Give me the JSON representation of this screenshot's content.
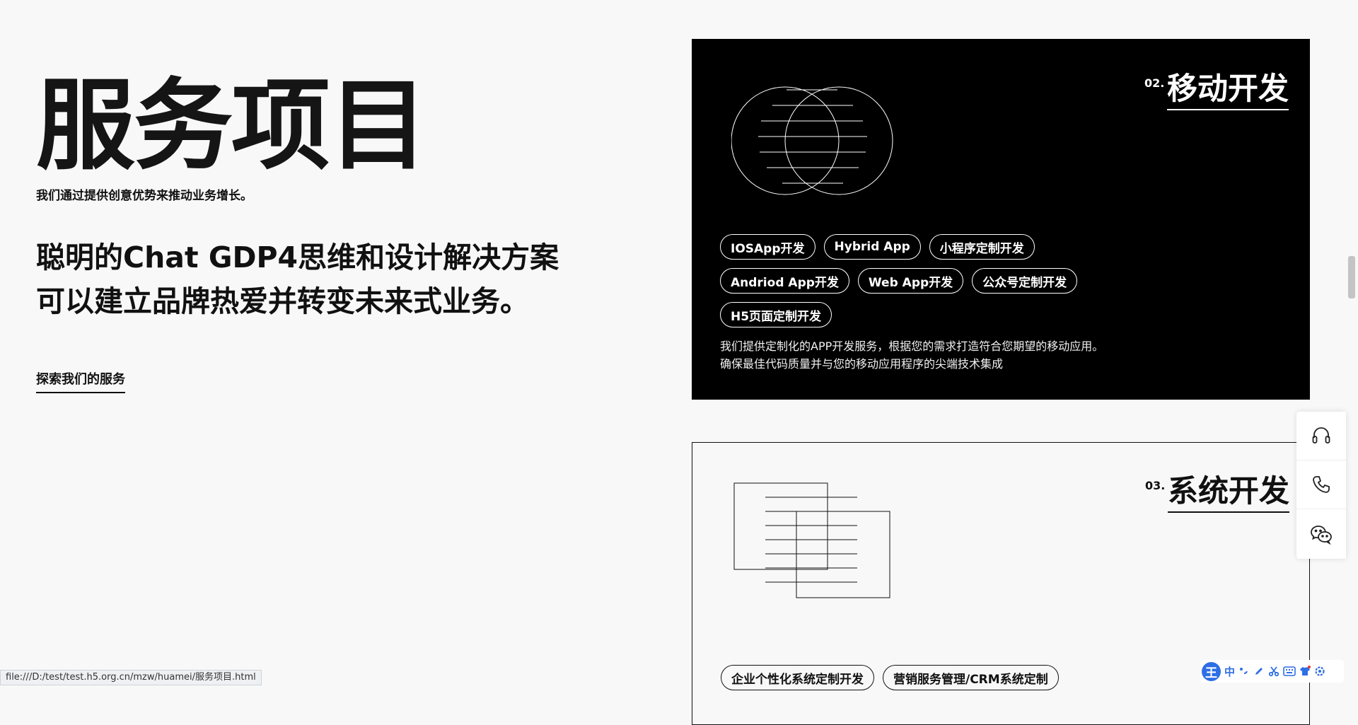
{
  "page": {
    "title": "服务项目",
    "subtitle": "我们通过提供创意优势来推动业务增长。",
    "hero_lines": [
      "聪明的Chat GDP4思维和设计解决方案",
      "可以建立品牌热爱并转变未来式业务。"
    ],
    "explore_link": "探索我们的服务"
  },
  "cards": [
    {
      "num": "02.",
      "title": "移动开发",
      "tags": [
        "IOSApp开发",
        "Hybrid App",
        "小程序定制开发",
        "Andriod App开发",
        "Web App开发",
        "公众号定制开发",
        "H5页面定制开发"
      ],
      "desc": [
        "我们提供定制化的APP开发服务，根据您的需求打造符合您期望的移动应用。",
        "确保最佳代码质量并与您的移动应用程序的尖端技术集成"
      ]
    },
    {
      "num": "03.",
      "title": "系统开发",
      "tags": [
        "企业个性化系统定制开发",
        "营销服务管理/CRM系统定制"
      ]
    }
  ],
  "float_bar": {
    "icons": [
      "headset-icon",
      "phone-icon",
      "wechat-icon"
    ]
  },
  "status_bar": {
    "url": "file:///D:/test/test.h5.org.cn/mzw/huamei/服务项目.html"
  },
  "ime": {
    "logo": "王",
    "mode": "中",
    "icons": [
      "punctuation-icon",
      "pen-icon",
      "scissors-icon",
      "keyboard-icon",
      "shirt-icon",
      "settings-icon"
    ]
  },
  "colors": {
    "background": "#f8f8f8",
    "card_dark": "#000000",
    "ime_accent": "#2f6fe4"
  }
}
